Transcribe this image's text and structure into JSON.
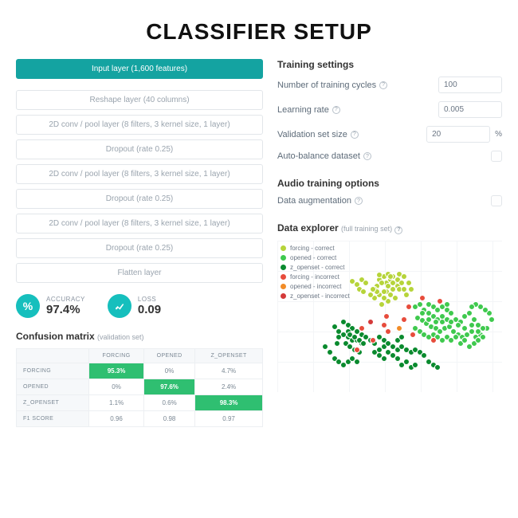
{
  "title": "CLASSIFIER SETUP",
  "layers": [
    {
      "label": "Input layer (1,600 features)",
      "selected": true
    },
    {
      "label": "Reshape layer (40 columns)",
      "selected": false
    },
    {
      "label": "2D conv / pool layer (8 filters, 3 kernel size, 1 layer)",
      "selected": false
    },
    {
      "label": "Dropout (rate 0.25)",
      "selected": false
    },
    {
      "label": "2D conv / pool layer (8 filters, 3 kernel size, 1 layer)",
      "selected": false
    },
    {
      "label": "Dropout (rate 0.25)",
      "selected": false
    },
    {
      "label": "2D conv / pool layer (8 filters, 3 kernel size, 1 layer)",
      "selected": false
    },
    {
      "label": "Dropout (rate 0.25)",
      "selected": false
    },
    {
      "label": "Flatten layer",
      "selected": false
    }
  ],
  "metrics": {
    "accuracy": {
      "label": "ACCURACY",
      "value": "97.4%"
    },
    "loss": {
      "label": "LOSS",
      "value": "0.09"
    }
  },
  "confusion": {
    "title": "Confusion matrix",
    "subtitle": "(validation set)",
    "cols": [
      "FORCING",
      "OPENED",
      "Z_OPENSET"
    ],
    "rows": [
      {
        "label": "FORCING",
        "cells": [
          {
            "v": "95.3%",
            "hit": true
          },
          {
            "v": "0%"
          },
          {
            "v": "4.7%"
          }
        ]
      },
      {
        "label": "OPENED",
        "cells": [
          {
            "v": "0%"
          },
          {
            "v": "97.6%",
            "hit": true
          },
          {
            "v": "2.4%"
          }
        ]
      },
      {
        "label": "Z_OPENSET",
        "cells": [
          {
            "v": "1.1%"
          },
          {
            "v": "0.6%"
          },
          {
            "v": "98.3%",
            "hit": true
          }
        ]
      },
      {
        "label": "F1 SCORE",
        "cells": [
          {
            "v": "0.96"
          },
          {
            "v": "0.98"
          },
          {
            "v": "0.97"
          }
        ]
      }
    ]
  },
  "settings": {
    "title": "Training settings",
    "cycles": {
      "label": "Number of training cycles",
      "value": "100"
    },
    "lr": {
      "label": "Learning rate",
      "value": "0.005"
    },
    "valset": {
      "label": "Validation set size",
      "value": "20",
      "unit": "%"
    },
    "balance": {
      "label": "Auto-balance dataset",
      "checked": false
    }
  },
  "audio": {
    "title": "Audio training options",
    "augment": {
      "label": "Data augmentation",
      "checked": false
    }
  },
  "explorer": {
    "title": "Data explorer",
    "subtitle": "(full training set)",
    "legend": [
      {
        "name": "forcing - correct",
        "color": "#b6d43a"
      },
      {
        "name": "opened - correct",
        "color": "#3fc94e"
      },
      {
        "name": "z_openset - correct",
        "color": "#0a8a2e"
      },
      {
        "name": "forcing - incorrect",
        "color": "#e74c3c"
      },
      {
        "name": "opened - incorrect",
        "color": "#f28c28"
      },
      {
        "name": "z_openset - incorrect",
        "color": "#d43a3a"
      }
    ]
  },
  "chart_data": {
    "type": "scatter",
    "title": "Data explorer (full training set)",
    "xlabel": "",
    "ylabel": "",
    "xlim": [
      0,
      100
    ],
    "ylim": [
      0,
      100
    ],
    "series": [
      {
        "name": "forcing - correct",
        "color": "#b6d43a",
        "points": [
          [
            44,
            24
          ],
          [
            46,
            22
          ],
          [
            47,
            26
          ],
          [
            48,
            20
          ],
          [
            49,
            24
          ],
          [
            50,
            22
          ],
          [
            51,
            26
          ],
          [
            52,
            28
          ],
          [
            53,
            30
          ],
          [
            45,
            26
          ],
          [
            43,
            28
          ],
          [
            42,
            30
          ],
          [
            47,
            32
          ],
          [
            50,
            30
          ],
          [
            49,
            34
          ],
          [
            51,
            36
          ],
          [
            48,
            38
          ],
          [
            46,
            36
          ],
          [
            44,
            34
          ],
          [
            43,
            32
          ],
          [
            42,
            36
          ],
          [
            45,
            40
          ],
          [
            41,
            30
          ],
          [
            40,
            34
          ],
          [
            44,
            21
          ],
          [
            46,
            32
          ],
          [
            50,
            26
          ],
          [
            52,
            24
          ],
          [
            54,
            26
          ],
          [
            53,
            20
          ],
          [
            55,
            22
          ],
          [
            48,
            28
          ],
          [
            49,
            22
          ],
          [
            55,
            30
          ],
          [
            56,
            34
          ],
          [
            57,
            26
          ],
          [
            58,
            30
          ],
          [
            32,
            25
          ],
          [
            34,
            27
          ],
          [
            36,
            24
          ],
          [
            38,
            26
          ],
          [
            35,
            30
          ],
          [
            37,
            32
          ]
        ]
      },
      {
        "name": "opened - correct",
        "color": "#3fc94e",
        "points": [
          [
            60,
            42
          ],
          [
            62,
            40
          ],
          [
            64,
            44
          ],
          [
            66,
            46
          ],
          [
            68,
            48
          ],
          [
            70,
            50
          ],
          [
            72,
            48
          ],
          [
            74,
            44
          ],
          [
            76,
            46
          ],
          [
            78,
            50
          ],
          [
            80,
            52
          ],
          [
            82,
            48
          ],
          [
            84,
            46
          ],
          [
            86,
            50
          ],
          [
            88,
            54
          ],
          [
            61,
            49
          ],
          [
            63,
            51
          ],
          [
            65,
            53
          ],
          [
            67,
            55
          ],
          [
            69,
            56
          ],
          [
            71,
            58
          ],
          [
            73,
            56
          ],
          [
            75,
            55
          ],
          [
            77,
            58
          ],
          [
            79,
            60
          ],
          [
            81,
            62
          ],
          [
            83,
            60
          ],
          [
            85,
            58
          ],
          [
            87,
            62
          ],
          [
            89,
            60
          ],
          [
            60,
            56
          ],
          [
            62,
            58
          ],
          [
            64,
            60
          ],
          [
            66,
            62
          ],
          [
            68,
            60
          ],
          [
            70,
            62
          ],
          [
            72,
            64
          ],
          [
            74,
            62
          ],
          [
            76,
            64
          ],
          [
            78,
            62
          ],
          [
            80,
            66
          ],
          [
            82,
            64
          ],
          [
            84,
            68
          ],
          [
            86,
            66
          ],
          [
            88,
            64
          ],
          [
            90,
            62
          ],
          [
            92,
            56
          ],
          [
            94,
            50
          ],
          [
            93,
            46
          ],
          [
            91,
            44
          ],
          [
            89,
            42
          ],
          [
            87,
            40
          ],
          [
            85,
            42
          ],
          [
            63,
            46
          ],
          [
            66,
            50
          ],
          [
            69,
            52
          ],
          [
            72,
            52
          ],
          [
            74,
            50
          ],
          [
            76,
            52
          ],
          [
            79,
            54
          ],
          [
            82,
            56
          ],
          [
            85,
            54
          ],
          [
            88,
            58
          ],
          [
            90,
            56
          ],
          [
            66,
            40
          ],
          [
            68,
            42
          ],
          [
            70,
            44
          ],
          [
            72,
            42
          ],
          [
            74,
            40
          ]
        ]
      },
      {
        "name": "z_openset - correct",
        "color": "#0a8a2e",
        "points": [
          [
            28,
            52
          ],
          [
            30,
            54
          ],
          [
            32,
            56
          ],
          [
            34,
            58
          ],
          [
            36,
            60
          ],
          [
            30,
            62
          ],
          [
            32,
            64
          ],
          [
            34,
            64
          ],
          [
            36,
            66
          ],
          [
            38,
            62
          ],
          [
            40,
            64
          ],
          [
            42,
            66
          ],
          [
            44,
            62
          ],
          [
            46,
            64
          ],
          [
            42,
            72
          ],
          [
            44,
            74
          ],
          [
            46,
            76
          ],
          [
            48,
            72
          ],
          [
            50,
            74
          ],
          [
            52,
            76
          ],
          [
            54,
            80
          ],
          [
            56,
            78
          ],
          [
            58,
            82
          ],
          [
            60,
            80
          ],
          [
            52,
            70
          ],
          [
            54,
            68
          ],
          [
            56,
            70
          ],
          [
            58,
            72
          ],
          [
            60,
            70
          ],
          [
            62,
            72
          ],
          [
            64,
            74
          ],
          [
            66,
            78
          ],
          [
            68,
            80
          ],
          [
            70,
            82
          ],
          [
            44,
            70
          ],
          [
            46,
            68
          ],
          [
            48,
            66
          ],
          [
            50,
            68
          ],
          [
            52,
            64
          ],
          [
            54,
            62
          ],
          [
            26,
            58
          ],
          [
            28,
            60
          ],
          [
            30,
            58
          ],
          [
            31,
            60
          ],
          [
            33,
            62
          ],
          [
            35,
            64
          ],
          [
            37,
            66
          ],
          [
            24,
            55
          ],
          [
            26,
            62
          ],
          [
            25,
            66
          ],
          [
            29,
            66
          ],
          [
            31,
            68
          ],
          [
            33,
            70
          ],
          [
            35,
            72
          ],
          [
            20,
            68
          ],
          [
            22,
            72
          ],
          [
            24,
            76
          ],
          [
            26,
            78
          ],
          [
            28,
            80
          ],
          [
            30,
            78
          ],
          [
            32,
            76
          ],
          [
            34,
            78
          ]
        ]
      },
      {
        "name": "forcing - incorrect",
        "color": "#e74c3c",
        "points": [
          [
            41,
            64
          ],
          [
            47,
            48
          ],
          [
            55,
            50
          ],
          [
            63,
            36
          ],
          [
            71,
            38
          ],
          [
            57,
            42
          ],
          [
            36,
            56
          ],
          [
            59,
            60
          ],
          [
            48,
            58
          ],
          [
            68,
            64
          ],
          [
            46,
            54
          ],
          [
            34,
            70
          ]
        ]
      },
      {
        "name": "opened - incorrect",
        "color": "#f28c28",
        "points": [
          [
            53,
            56
          ]
        ]
      },
      {
        "name": "z_openset - incorrect",
        "color": "#d43a3a",
        "points": [
          [
            40,
            52
          ]
        ]
      }
    ]
  }
}
